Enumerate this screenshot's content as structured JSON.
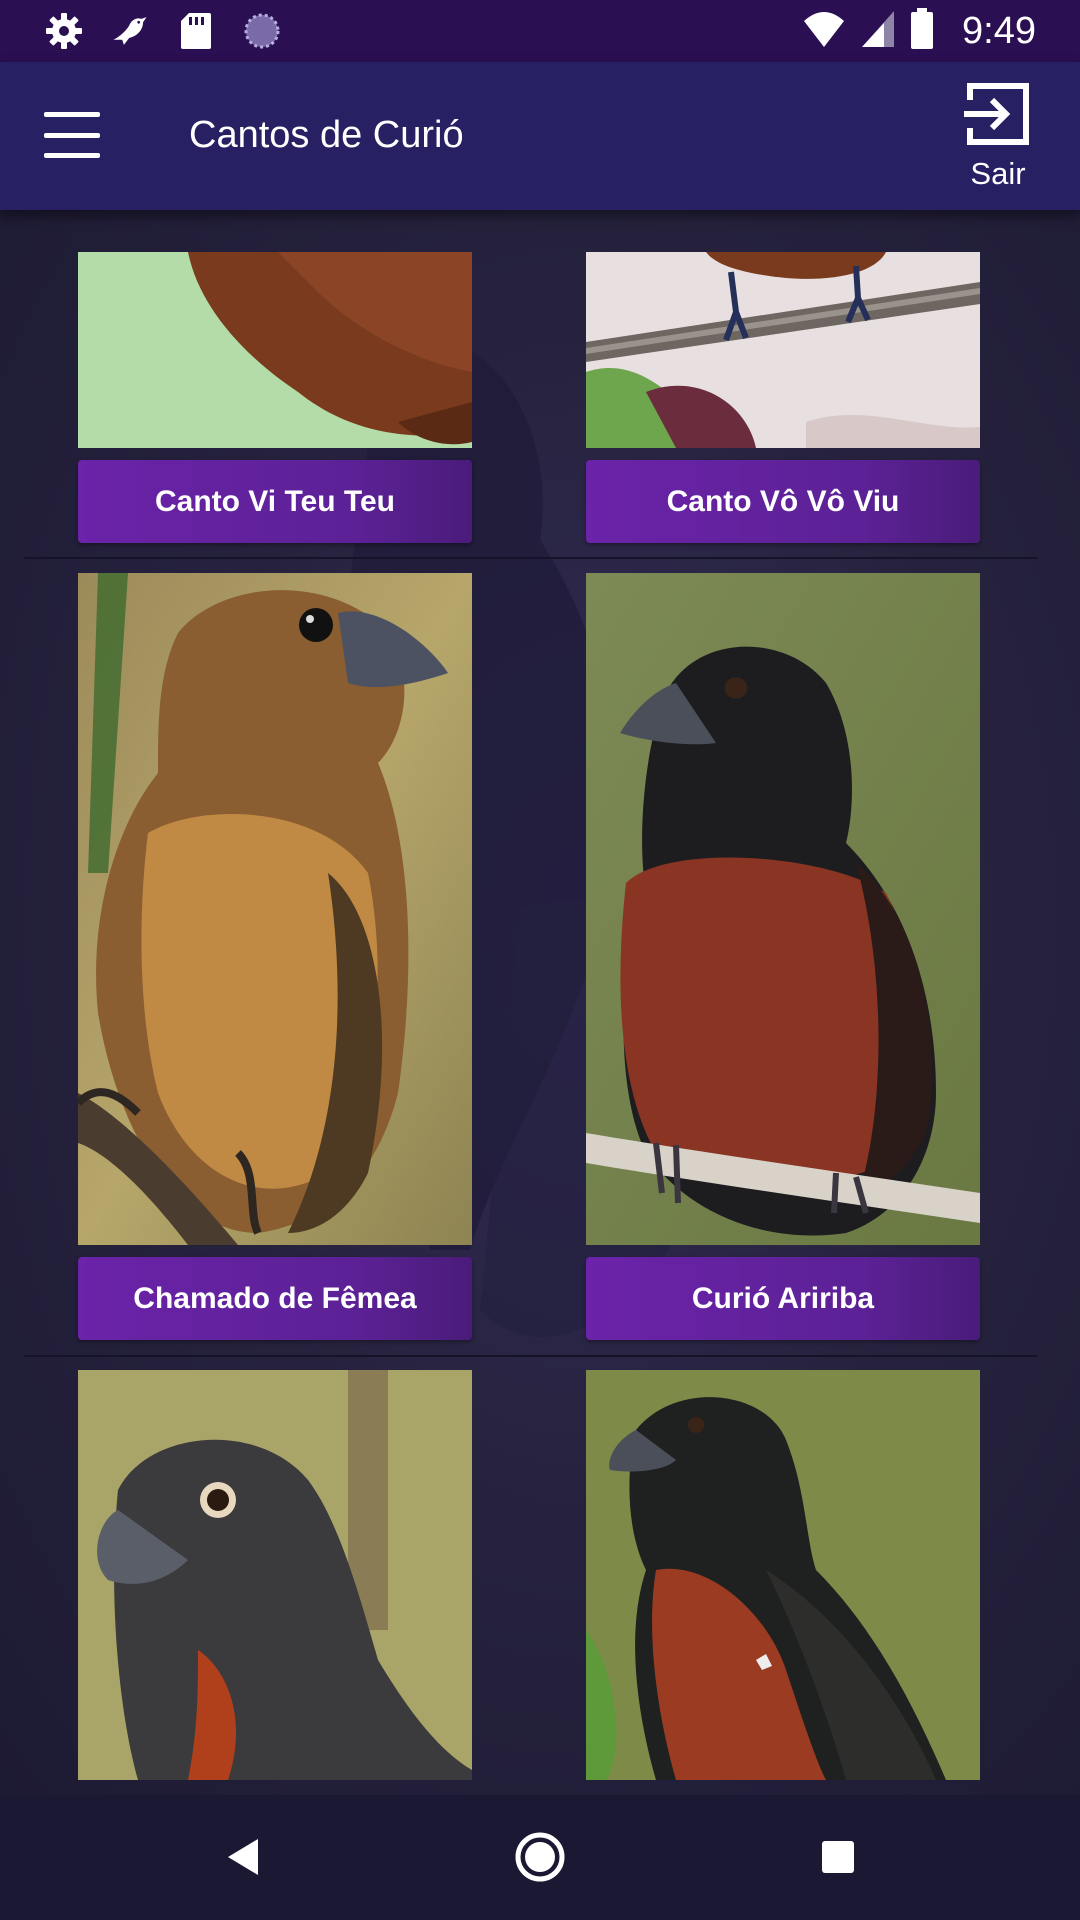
{
  "status_bar": {
    "time": "9:49",
    "icons_left": [
      "gear-icon",
      "bird-icon",
      "sd-card-icon",
      "loading-circle-icon"
    ],
    "icons_right": [
      "wifi-icon",
      "signal-icon",
      "battery-icon"
    ]
  },
  "app_bar": {
    "title": "Cantos de Curió",
    "menu_icon": "hamburger-menu-icon",
    "logout_icon": "logout-icon",
    "logout_label": "Sair"
  },
  "cards": [
    {
      "label": "Canto Vi Teu Teu",
      "image": "brown-bird-belly-crop"
    },
    {
      "label": "Canto Vô Vô Viu",
      "image": "bird-feet-on-branch"
    },
    {
      "label": "Chamado de Fêmea",
      "image": "female-brown-curio"
    },
    {
      "label": "Curió Aririba",
      "image": "black-chestnut-curio-on-branch"
    },
    {
      "label": "",
      "image": "dark-curio-portrait"
    },
    {
      "label": "",
      "image": "black-chestnut-curio-side"
    }
  ],
  "colors": {
    "status_bar": "#2a0f52",
    "app_bar": "#272062",
    "button": "#6b23a9",
    "background": "#1d1a37"
  },
  "nav_bar": {
    "icons": [
      "back-icon",
      "home-icon",
      "recents-icon"
    ]
  }
}
